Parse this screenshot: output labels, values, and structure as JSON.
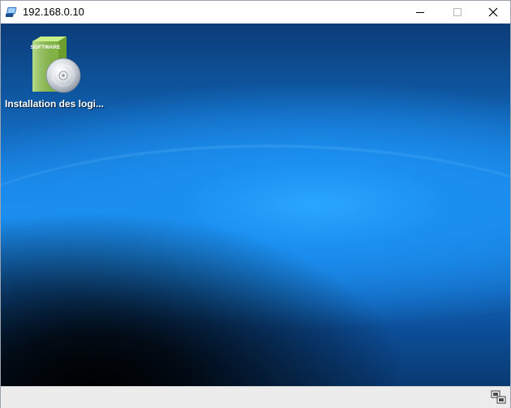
{
  "window": {
    "title": "192.168.0.10"
  },
  "controls": {
    "minimize_icon": "minimize-icon",
    "maximize_icon": "maximize-icon",
    "close_icon": "close-icon"
  },
  "desktop": {
    "icons": [
      {
        "label": "Installation des logi...",
        "icon": "software-install-icon",
        "box_text": "SOFTWARE"
      }
    ]
  },
  "statusbar": {
    "icon": "network-connection-icon"
  },
  "colors": {
    "desktop_top": "#0b3c78",
    "desktop_band": "#1b8ff0",
    "desktop_dark": "#000000",
    "statusbar_bg": "#ececec",
    "box_green": "#8fc84a"
  }
}
